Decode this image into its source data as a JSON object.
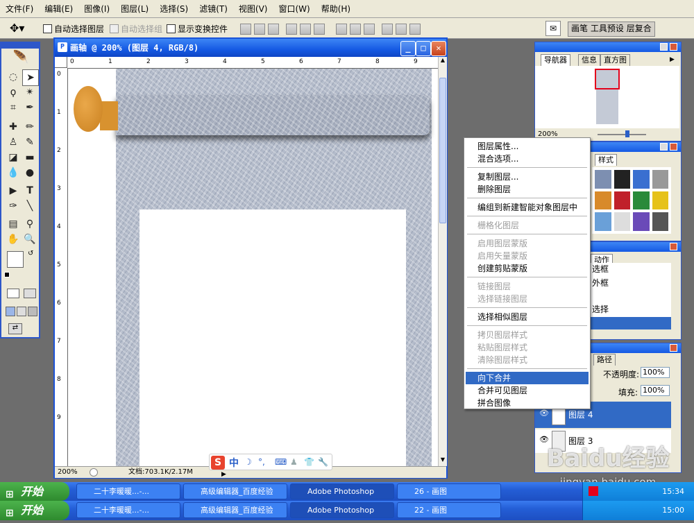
{
  "menu": [
    "文件(F)",
    "编辑(E)",
    "图像(I)",
    "图层(L)",
    "选择(S)",
    "滤镜(T)",
    "视图(V)",
    "窗口(W)",
    "帮助(H)"
  ],
  "options": {
    "auto_select_layer": "自动选择图层",
    "auto_select_group": "自动选择组",
    "show_transform": "显示变换控件",
    "tabs": [
      "画笔",
      "工具预设",
      "层复合"
    ]
  },
  "doc": {
    "title": "画轴 @ 200% (图层 4, RGB/8)",
    "zoom": "200%",
    "file_info": "文档:703.1K/2.17M",
    "ruler_top": [
      "0",
      "1",
      "2",
      "3",
      "4",
      "5",
      "6",
      "7",
      "8",
      "9"
    ],
    "ruler_left": [
      "0",
      "1",
      "2",
      "3",
      "4",
      "5",
      "6",
      "7",
      "8",
      "9"
    ]
  },
  "panels": {
    "navigator_tabs": [
      "导航器",
      "信息",
      "直方图"
    ],
    "nav_zoom": "200%",
    "styles_tab": "样式",
    "actions_tab": "动作",
    "actions_items": [
      "选框",
      "外框",
      "选择"
    ],
    "layers_tab": "路径",
    "opacity_label": "不透明度:",
    "opacity_value": "100%",
    "fill_label": "填充:",
    "fill_value": "100%",
    "layers": [
      "图层 4",
      "图层 3"
    ]
  },
  "ctxmenu": [
    {
      "label": "图层属性...",
      "state": "enabled"
    },
    {
      "label": "混合选项...",
      "state": "enabled"
    },
    {
      "sep": true
    },
    {
      "label": "复制图层...",
      "state": "enabled"
    },
    {
      "label": "删除图层",
      "state": "enabled"
    },
    {
      "sep": true
    },
    {
      "label": "编组到新建智能对象图层中",
      "state": "enabled"
    },
    {
      "sep": true
    },
    {
      "label": "栅格化图层",
      "state": "disabled"
    },
    {
      "sep": true
    },
    {
      "label": "启用图层蒙版",
      "state": "disabled"
    },
    {
      "label": "启用矢量蒙版",
      "state": "disabled"
    },
    {
      "label": "创建剪贴蒙版",
      "state": "enabled"
    },
    {
      "sep": true
    },
    {
      "label": "链接图层",
      "state": "disabled"
    },
    {
      "label": "选择链接图层",
      "state": "disabled"
    },
    {
      "sep": true
    },
    {
      "label": "选择相似图层",
      "state": "enabled"
    },
    {
      "sep": true
    },
    {
      "label": "拷贝图层样式",
      "state": "disabled"
    },
    {
      "label": "粘贴图层样式",
      "state": "disabled"
    },
    {
      "label": "清除图层样式",
      "state": "disabled"
    },
    {
      "sep": true
    },
    {
      "label": "向下合并",
      "state": "highlighted"
    },
    {
      "label": "合并可见图层",
      "state": "enabled"
    },
    {
      "label": "拼合图像",
      "state": "enabled"
    }
  ],
  "ime": {
    "label": "中"
  },
  "taskbar1": {
    "start": "开始",
    "items": [
      "二十李暖暖...-...",
      "高级编辑器_百度经验",
      "Adobe Photoshop",
      "26 - 画图"
    ],
    "clock": "15:34"
  },
  "taskbar2": {
    "start": "开始",
    "items": [
      "二十李暖暖...-...",
      "高级编辑器_百度经验",
      "Adobe Photoshop",
      "22 - 画图"
    ],
    "clock": "15:00"
  },
  "watermark": {
    "brand": "Baidu经验",
    "url": "jingyan.baidu.com"
  },
  "colors": {
    "titlebar": "#1559e3",
    "highlight": "#316ac5",
    "scroll_knob": "#d49a3a",
    "bg_color": "#e3001b"
  }
}
